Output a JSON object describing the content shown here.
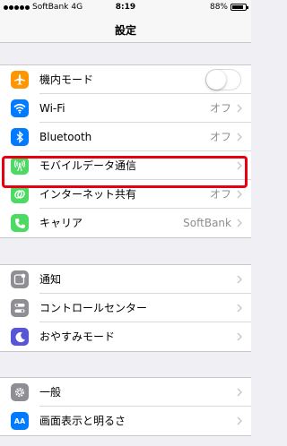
{
  "status_bar": {
    "carrier": "SoftBank",
    "network": "4G",
    "time": "8:19",
    "battery": "88%",
    "battery_level": 0.88
  },
  "nav": {
    "title": "設定"
  },
  "groups": [
    {
      "rows": [
        {
          "label": "機内モード",
          "value": "",
          "icon": "airplane-icon",
          "icon_color": "#ff9500",
          "control": "toggle",
          "toggle_on": false
        },
        {
          "label": "Wi-Fi",
          "value": "オフ",
          "icon": "wifi-icon",
          "icon_color": "#007aff"
        },
        {
          "label": "Bluetooth",
          "value": "オフ",
          "icon": "bluetooth-icon",
          "icon_color": "#007aff"
        },
        {
          "label": "モバイルデータ通信",
          "value": "",
          "icon": "antenna-icon",
          "icon_color": "#4cd964"
        },
        {
          "label": "インターネット共有",
          "value": "オフ",
          "icon": "link-icon",
          "icon_color": "#4cd964",
          "highlighted": true
        },
        {
          "label": "キャリア",
          "value": "SoftBank",
          "icon": "phone-icon",
          "icon_color": "#4cd964"
        }
      ]
    },
    {
      "rows": [
        {
          "label": "通知",
          "value": "",
          "icon": "notification-icon",
          "icon_color": "#8e8e93"
        },
        {
          "label": "コントロールセンター",
          "value": "",
          "icon": "control-center-icon",
          "icon_color": "#8e8e93"
        },
        {
          "label": "おやすみモード",
          "value": "",
          "icon": "moon-icon",
          "icon_color": "#5856d6"
        }
      ]
    },
    {
      "rows": [
        {
          "label": "一般",
          "value": "",
          "icon": "gear-icon",
          "icon_color": "#8e8e93"
        },
        {
          "label": "画面表示と明るさ",
          "value": "",
          "icon": "display-icon",
          "icon_color": "#007aff",
          "icon_text": "AA"
        }
      ]
    }
  ],
  "colors": {
    "highlight": "#e50012",
    "background": "#efeff4",
    "value_text": "#8e8e93"
  }
}
